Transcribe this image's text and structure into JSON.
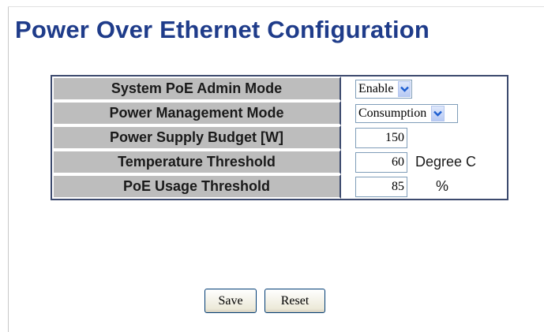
{
  "title": "Power Over Ethernet Configuration",
  "rows": [
    {
      "label": "System PoE Admin Mode",
      "type": "select",
      "value": "Enable"
    },
    {
      "label": "Power Management Mode",
      "type": "select",
      "value": "Consumption"
    },
    {
      "label": "Power Supply Budget [W]",
      "type": "number",
      "value": "150",
      "unit": ""
    },
    {
      "label": "Temperature Threshold",
      "type": "number",
      "value": "60",
      "unit": "Degree C"
    },
    {
      "label": "PoE Usage Threshold",
      "type": "number",
      "value": "85",
      "unit": "%"
    }
  ],
  "buttons": {
    "save": "Save",
    "reset": "Reset"
  },
  "colors": {
    "title": "#1f3c8a",
    "label_bg": "#bdbdbd",
    "table_border": "#3c4a6e",
    "dropdown_arrow": "#1f5fd0"
  },
  "icons": {
    "dropdown": "chevron-down-icon"
  }
}
